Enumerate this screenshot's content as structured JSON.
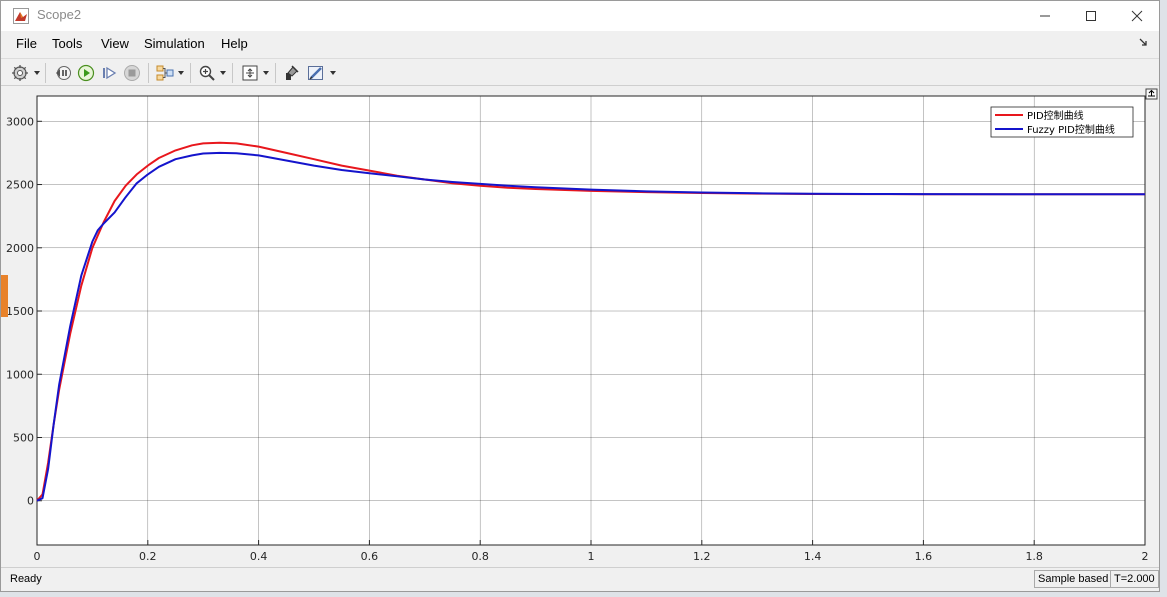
{
  "window": {
    "title": "Scope2"
  },
  "menu": {
    "items": [
      "File",
      "Tools",
      "View",
      "Simulation",
      "Help"
    ]
  },
  "toolbar": {
    "icons": [
      "settings-icon",
      "step-back-icon",
      "run-icon",
      "step-forward-icon",
      "stop-icon",
      "signal-selector-icon",
      "zoom-icon",
      "fit-view-icon",
      "highlight-icon",
      "style-icon"
    ]
  },
  "status": {
    "ready": "Ready",
    "sample": "Sample based",
    "time": "T=2.000"
  },
  "colors": {
    "pid": "#e8171d",
    "fuzzy": "#1414cc",
    "accent": "#e8822a"
  },
  "chart_data": {
    "type": "line",
    "xlim": [
      0,
      2
    ],
    "ylim": [
      -350,
      3200
    ],
    "xticks": [
      0,
      0.2,
      0.4,
      0.6,
      0.8,
      1,
      1.2,
      1.4,
      1.6,
      1.8,
      2
    ],
    "xtick_labels": [
      "0",
      "0.2",
      "0.4",
      "0.6",
      "0.8",
      "1",
      "1.2",
      "1.4",
      "1.6",
      "1.8",
      "2"
    ],
    "yticks": [
      0,
      500,
      1000,
      1500,
      2000,
      2500,
      3000
    ],
    "ytick_labels": [
      "0",
      "500",
      "1000",
      "1500",
      "2000",
      "2500",
      "3000"
    ],
    "grid": true,
    "legend_position": "top-right",
    "series": [
      {
        "name": "PID控制曲线",
        "color": "#e8171d",
        "x": [
          0,
          0.01,
          0.02,
          0.03,
          0.04,
          0.05,
          0.06,
          0.08,
          0.1,
          0.12,
          0.14,
          0.16,
          0.18,
          0.2,
          0.22,
          0.25,
          0.28,
          0.3,
          0.33,
          0.36,
          0.4,
          0.45,
          0.5,
          0.55,
          0.6,
          0.65,
          0.7,
          0.75,
          0.8,
          0.85,
          0.9,
          1.0,
          1.1,
          1.2,
          1.3,
          1.4,
          1.5,
          1.6,
          1.8,
          2.0
        ],
        "y": [
          0,
          50,
          300,
          600,
          880,
          1100,
          1320,
          1700,
          2000,
          2200,
          2370,
          2490,
          2580,
          2650,
          2710,
          2770,
          2810,
          2825,
          2830,
          2825,
          2800,
          2750,
          2700,
          2650,
          2610,
          2570,
          2540,
          2510,
          2490,
          2475,
          2465,
          2450,
          2440,
          2433,
          2428,
          2425,
          2424,
          2423,
          2423,
          2423
        ]
      },
      {
        "name": "Fuzzy PID控制曲线",
        "color": "#1414cc",
        "x": [
          0,
          0.01,
          0.02,
          0.03,
          0.04,
          0.05,
          0.06,
          0.08,
          0.1,
          0.11,
          0.12,
          0.14,
          0.16,
          0.18,
          0.2,
          0.22,
          0.25,
          0.28,
          0.3,
          0.33,
          0.36,
          0.4,
          0.45,
          0.5,
          0.55,
          0.6,
          0.65,
          0.7,
          0.75,
          0.8,
          0.85,
          0.9,
          1.0,
          1.1,
          1.2,
          1.3,
          1.4,
          1.5,
          1.6,
          1.8,
          2.0
        ],
        "y": [
          0,
          20,
          250,
          600,
          920,
          1150,
          1380,
          1780,
          2050,
          2140,
          2190,
          2280,
          2400,
          2510,
          2580,
          2640,
          2700,
          2730,
          2745,
          2750,
          2748,
          2730,
          2690,
          2650,
          2615,
          2590,
          2565,
          2540,
          2520,
          2505,
          2490,
          2478,
          2460,
          2446,
          2437,
          2431,
          2427,
          2425,
          2424,
          2423,
          2423
        ]
      }
    ]
  }
}
